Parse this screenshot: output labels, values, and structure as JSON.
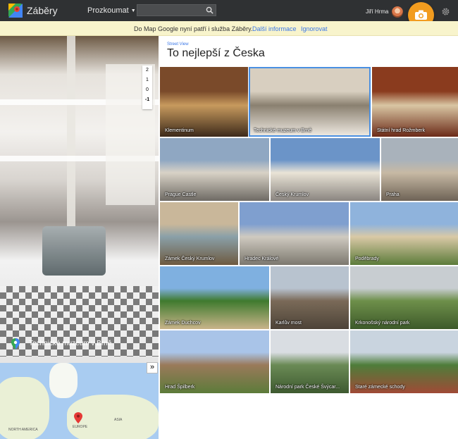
{
  "header": {
    "app_title": "Záběry",
    "explore_label": "Prozkoumat",
    "search_placeholder": "",
    "user_name": "Jiří Hrma"
  },
  "notice": {
    "message": "Do Map Google nyní patří i služba Záběry.",
    "more_info": "Další informace",
    "ignore": "Ignorovat"
  },
  "panorama": {
    "caption": "Technické muzeum v Brně",
    "zoom_levels": [
      "2",
      "1",
      "0",
      "-1"
    ],
    "zoom_current": "-1"
  },
  "map": {
    "labels": [
      "NORTH AMERICA",
      "EUROPE",
      "ASIA"
    ]
  },
  "gallery": {
    "category": "Street View",
    "title": "To nejlepší z Česka",
    "tiles": [
      {
        "label": "Klementinum",
        "colors": [
          "#7a4a2a",
          "#c79a5e",
          "#3d2a1a"
        ]
      },
      {
        "label": "Technické muzeum v Brně",
        "colors": [
          "#d8cfc0",
          "#8a8070",
          "#f1ece4"
        ]
      },
      {
        "label": "Státní hrad Rožmberk",
        "colors": [
          "#8a3b1e",
          "#d9c6a3",
          "#6b2a18"
        ]
      },
      {
        "label": "Prague Castle",
        "colors": [
          "#8fa7c2",
          "#d8d2c6",
          "#6e6a64"
        ]
      },
      {
        "label": "Český Krumlov",
        "colors": [
          "#6b94c8",
          "#e9e3d6",
          "#8a8580"
        ]
      },
      {
        "label": "Praha",
        "colors": [
          "#a9b2bb",
          "#c7b9a4",
          "#6e6356"
        ]
      },
      {
        "label": "Zámek Český Krumlov",
        "colors": [
          "#c9b79a",
          "#8aa0a8",
          "#6e5a40"
        ]
      },
      {
        "label": "Hradec Králové",
        "colors": [
          "#7f9fcf",
          "#cfcac0",
          "#7c786f"
        ]
      },
      {
        "label": "Poděbrady",
        "colors": [
          "#8fb3dc",
          "#d9c9a6",
          "#5c7b3a"
        ]
      },
      {
        "label": "Zámek Duchcov",
        "colors": [
          "#7fb0e0",
          "#3f7a2e",
          "#c9b48a"
        ]
      },
      {
        "label": "Karlův most",
        "colors": [
          "#b8c3cf",
          "#7a6a58",
          "#4d4338"
        ]
      },
      {
        "label": "Krkonošský národní park",
        "colors": [
          "#c8cdd1",
          "#6e8f4a",
          "#3d5a2a"
        ]
      },
      {
        "label": "Hrad Špilberk",
        "colors": [
          "#a9c4e8",
          "#9a7a5a",
          "#5c7b3a"
        ]
      },
      {
        "label": "Národní park České Švýcar...",
        "colors": [
          "#d9dde2",
          "#6a8a55",
          "#3e5a30"
        ]
      },
      {
        "label": "Staré zámecké schody",
        "colors": [
          "#c9d4df",
          "#4e7d3a",
          "#a04a36"
        ]
      }
    ]
  }
}
